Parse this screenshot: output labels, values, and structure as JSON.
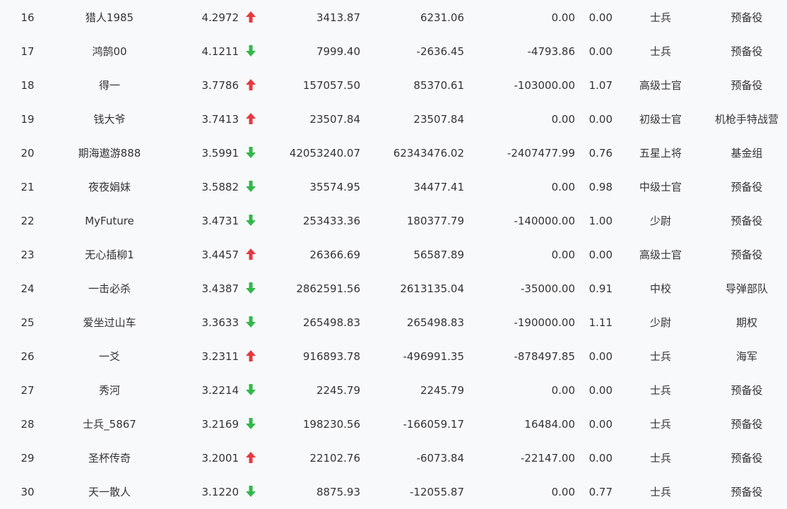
{
  "colors": {
    "up": "#e8383d",
    "down": "#30b84a",
    "text": "#333333",
    "background": "#f8f9fb"
  },
  "rows": [
    {
      "rank": "16",
      "name": "猎人1985",
      "score": "4.2972",
      "trend": "up",
      "trend_icon": "arrow-up-icon",
      "v1": "3413.87",
      "v2": "6231.06",
      "v3": "0.00",
      "v4": "0.00",
      "rank_title": "士兵",
      "group": "预备役"
    },
    {
      "rank": "17",
      "name": "鸿鹄00",
      "score": "4.1211",
      "trend": "down",
      "trend_icon": "arrow-down-icon",
      "v1": "7999.40",
      "v2": "-2636.45",
      "v3": "-4793.86",
      "v4": "0.00",
      "rank_title": "士兵",
      "group": "预备役"
    },
    {
      "rank": "18",
      "name": "得一",
      "score": "3.7786",
      "trend": "up",
      "trend_icon": "arrow-up-icon",
      "v1": "157057.50",
      "v2": "85370.61",
      "v3": "-103000.00",
      "v4": "1.07",
      "rank_title": "高级士官",
      "group": "预备役"
    },
    {
      "rank": "19",
      "name": "钱大爷",
      "score": "3.7413",
      "trend": "up",
      "trend_icon": "arrow-up-icon",
      "v1": "23507.84",
      "v2": "23507.84",
      "v3": "0.00",
      "v4": "0.00",
      "rank_title": "初级士官",
      "group": "机枪手特战营"
    },
    {
      "rank": "20",
      "name": "期海遨游888",
      "score": "3.5991",
      "trend": "down",
      "trend_icon": "arrow-down-icon",
      "v1": "42053240.07",
      "v2": "62343476.02",
      "v3": "-2407477.99",
      "v4": "0.76",
      "rank_title": "五星上将",
      "group": "基金组"
    },
    {
      "rank": "21",
      "name": "夜夜娟妹",
      "score": "3.5882",
      "trend": "down",
      "trend_icon": "arrow-down-icon",
      "v1": "35574.95",
      "v2": "34477.41",
      "v3": "0.00",
      "v4": "0.98",
      "rank_title": "中级士官",
      "group": "预备役"
    },
    {
      "rank": "22",
      "name": "MyFuture",
      "score": "3.4731",
      "trend": "down",
      "trend_icon": "arrow-down-icon",
      "v1": "253433.36",
      "v2": "180377.79",
      "v3": "-140000.00",
      "v4": "1.00",
      "rank_title": "少尉",
      "group": "预备役"
    },
    {
      "rank": "23",
      "name": "无心插柳1",
      "score": "3.4457",
      "trend": "up",
      "trend_icon": "arrow-up-icon",
      "v1": "26366.69",
      "v2": "56587.89",
      "v3": "0.00",
      "v4": "0.00",
      "rank_title": "高级士官",
      "group": "预备役"
    },
    {
      "rank": "24",
      "name": "一击必杀",
      "score": "3.4387",
      "trend": "down",
      "trend_icon": "arrow-down-icon",
      "v1": "2862591.56",
      "v2": "2613135.04",
      "v3": "-35000.00",
      "v4": "0.91",
      "rank_title": "中校",
      "group": "导弹部队"
    },
    {
      "rank": "25",
      "name": "爱坐过山车",
      "score": "3.3633",
      "trend": "down",
      "trend_icon": "arrow-down-icon",
      "v1": "265498.83",
      "v2": "265498.83",
      "v3": "-190000.00",
      "v4": "1.11",
      "rank_title": "少尉",
      "group": "期权"
    },
    {
      "rank": "26",
      "name": "一爻",
      "score": "3.2311",
      "trend": "up",
      "trend_icon": "arrow-up-icon",
      "v1": "916893.78",
      "v2": "-496991.35",
      "v3": "-878497.85",
      "v4": "0.00",
      "rank_title": "士兵",
      "group": "海军"
    },
    {
      "rank": "27",
      "name": "秀河",
      "score": "3.2214",
      "trend": "down",
      "trend_icon": "arrow-down-icon",
      "v1": "2245.79",
      "v2": "2245.79",
      "v3": "0.00",
      "v4": "0.00",
      "rank_title": "士兵",
      "group": "预备役"
    },
    {
      "rank": "28",
      "name": "士兵_5867",
      "score": "3.2169",
      "trend": "down",
      "trend_icon": "arrow-down-icon",
      "v1": "198230.56",
      "v2": "-166059.17",
      "v3": "16484.00",
      "v4": "0.00",
      "rank_title": "士兵",
      "group": "预备役"
    },
    {
      "rank": "29",
      "name": "圣杯传奇",
      "score": "3.2001",
      "trend": "up",
      "trend_icon": "arrow-up-icon",
      "v1": "22102.76",
      "v2": "-6073.84",
      "v3": "-22147.00",
      "v4": "0.00",
      "rank_title": "士兵",
      "group": "预备役"
    },
    {
      "rank": "30",
      "name": "天一散人",
      "score": "3.1220",
      "trend": "down",
      "trend_icon": "arrow-down-icon",
      "v1": "8875.93",
      "v2": "-12055.87",
      "v3": "0.00",
      "v4": "0.77",
      "rank_title": "士兵",
      "group": "预备役"
    }
  ]
}
